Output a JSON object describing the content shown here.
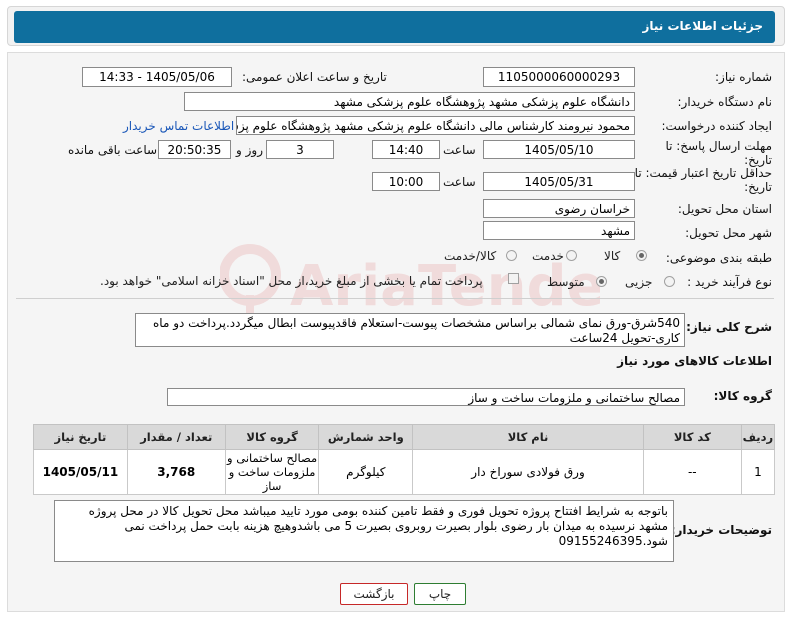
{
  "header": {
    "title": "جزئیات اطلاعات نیاز"
  },
  "fields": {
    "need_number_label": "شماره نیاز:",
    "need_number": "1105000060000293",
    "announce_label": "تاریخ و ساعت اعلان عمومی:",
    "announce_value": "1405/05/06 - 14:33",
    "buyer_org_label": "نام دستگاه خریدار:",
    "buyer_org": "دانشگاه علوم پزشکی مشهد   پژوهشگاه علوم پزشکی مشهد",
    "creator_label": "ایجاد کننده درخواست:",
    "creator": "محمود نیرومند کارشناس مالی دانشگاه علوم پزشکی مشهد   پژوهشگاه علوم پزشکی مشهد",
    "contact_link": "اطلاعات تماس خریدار",
    "deadline_label": "مهلت ارسال پاسخ: تا تاریخ:",
    "deadline_date": "1405/05/10",
    "hour_label": "ساعت",
    "deadline_time": "14:40",
    "day_count": "3",
    "day_and_label": "روز و",
    "remaining_time": "20:50:35",
    "remaining_label": "ساعت باقی مانده",
    "validity_label": "حداقل تاریخ اعتبار قیمت: تا تاریخ:",
    "validity_date": "1405/05/31",
    "validity_hour_label": "ساعت",
    "validity_time": "10:00",
    "province_label": "استان محل تحویل:",
    "province": "خراسان رضوی",
    "city_label": "شهر محل تحویل:",
    "city": "مشهد",
    "category_label": "طبقه بندی موضوعی:",
    "category_options": [
      "کالا",
      "خدمت",
      "کالا/خدمت"
    ],
    "purchase_type_label": "نوع فرآیند خرید :",
    "purchase_options": [
      "جزیی",
      "متوسط"
    ],
    "treasury_note": "پرداخت تمام یا بخشی از مبلغ خرید،از محل \"اسناد خزانه اسلامی\" خواهد بود."
  },
  "description": {
    "label": "شرح کلی نیاز:",
    "text": "540شرق-ورق نمای شمالی براساس مشخصات پیوست-استعلام فاقدپیوست ابطال میگردد.پرداخت دو ماه کاری-تحویل 24ساعت"
  },
  "goods": {
    "section_title": "اطلاعات کالاهای مورد نیاز",
    "group_label": "گروه کالا:",
    "group_value": "مصالح ساختمانی و ملزومات ساخت و ساز",
    "columns": [
      "ردیف",
      "کد کالا",
      "نام کالا",
      "واحد شمارش",
      "گروه کالا",
      "تعداد / مقدار",
      "تاریخ نیاز"
    ],
    "rows": [
      {
        "index": "1",
        "code": "--",
        "name": "ورق فولادی سوراخ دار",
        "unit": "کیلوگرم",
        "group": "مصالح ساختمانی و ملزومات ساخت و ساز",
        "qty": "3,768",
        "date": "1405/05/11"
      }
    ]
  },
  "buyer_notes": {
    "label": "توضیحات خریدار:",
    "text": "باتوجه به شرایط افتتاح پروژه تحویل فوری و فقط تامین کننده بومی مورد تایید میباشد محل تحویل کالا در محل پروژه  مشهد نرسیده به میدان بار رضوی بلوار بصیرت روبروی بصیرت 5 می باشدوهیچ هزینه بابت حمل  پرداخت نمی شود.09155246395"
  },
  "buttons": {
    "print": "چاپ",
    "back": "بازگشت"
  },
  "colors": {
    "header": "#0f6f9e",
    "link": "#1a57b8",
    "back_border": "#c62828",
    "print_border": "#2e7d32"
  }
}
